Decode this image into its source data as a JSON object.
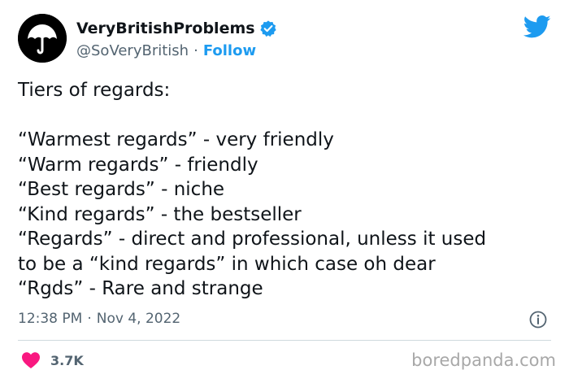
{
  "author": {
    "display_name": "VeryBritishProblems",
    "handle": "@SoVeryBritish",
    "separator": "·",
    "follow_label": "Follow",
    "verified": true
  },
  "tweet": {
    "title_line": "Tiers of regards:",
    "lines": [
      "“Warmest regards” - very friendly",
      "“Warm regards” - friendly",
      "“Best regards” - niche",
      "“Kind regards” - the bestseller",
      "“Regards” - direct and professional, unless it used",
      "to be a “kind regards” in which case oh dear",
      "“Rgds” - Rare and strange"
    ],
    "time": "12:38 PM",
    "separator": "·",
    "date": "Nov 4, 2022"
  },
  "engagement": {
    "like_count": "3.7K"
  },
  "watermark": "boredpanda.com",
  "icons": {
    "avatar": "umbrella-icon",
    "verified": "verified-badge-icon",
    "brand": "twitter-bird-icon",
    "info": "info-icon",
    "like": "heart-icon"
  },
  "colors": {
    "accent": "#1d9bf0",
    "text": "#0f1419",
    "secondary": "#536471",
    "like": "#f91880",
    "divider": "#cfd9de"
  }
}
